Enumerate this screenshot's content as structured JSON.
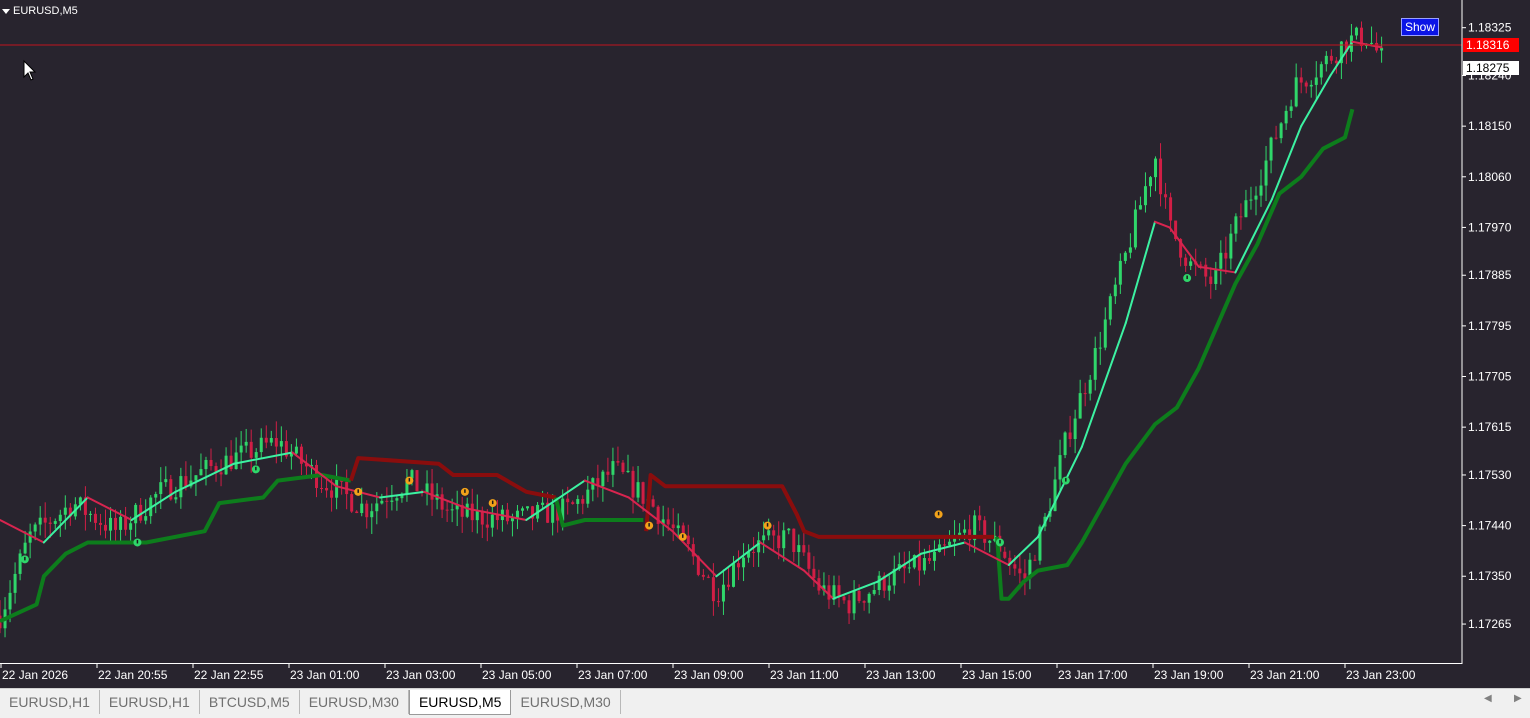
{
  "window": {
    "symbol_label": "EURUSD,M5",
    "show_button": "Show"
  },
  "tabs": [
    {
      "label": "EURUSD,H1",
      "active": false
    },
    {
      "label": "EURUSD,H1",
      "active": false
    },
    {
      "label": "BTCUSD,M5",
      "active": false
    },
    {
      "label": "EURUSD,M30",
      "active": false
    },
    {
      "label": "EURUSD,M5",
      "active": true
    },
    {
      "label": "EURUSD,M30",
      "active": false
    }
  ],
  "tab_scroll": {
    "left_icon": "triangle-left-icon",
    "right_icon": "triangle-right-icon"
  },
  "colors": {
    "background": "#28242e",
    "bull_candle": "#2fd66a",
    "bear_candle": "#d11e45",
    "ma_up": "#3cf2a2",
    "ma_down": "#d8244f",
    "trail_support": "#0d7d1c",
    "trail_resistance": "#8a0d0d",
    "ask_line": "#c0151f",
    "ask_badge": "#ff0000",
    "bid_badge": "#ffffff",
    "signal_up": "#2fd66a",
    "signal_down": "#f2a21a"
  },
  "chart_data": {
    "type": "candlestick",
    "symbol": "EURUSD",
    "timeframe": "M5",
    "ylim": [
      1.1721,
      1.1836
    ],
    "y_ticks": [
      "1.18325",
      "1.18240",
      "1.18150",
      "1.18060",
      "1.17970",
      "1.17885",
      "1.17795",
      "1.17705",
      "1.17615",
      "1.17530",
      "1.17440",
      "1.17350",
      "1.17265"
    ],
    "x_ticks": [
      "22 Jan 2026",
      "22 Jan 20:55",
      "22 Jan 22:55",
      "23 Jan 01:00",
      "23 Jan 03:00",
      "23 Jan 05:00",
      "23 Jan 07:00",
      "23 Jan 09:00",
      "23 Jan 11:00",
      "23 Jan 13:00",
      "23 Jan 15:00",
      "23 Jan 17:00",
      "23 Jan 19:00",
      "23 Jan 21:00",
      "23 Jan 23:00"
    ],
    "ask_price": "1.18316",
    "bid_price": "1.18275",
    "price_path": [
      [
        0,
        1.1728
      ],
      [
        0.02,
        1.1742
      ],
      [
        0.05,
        1.1748
      ],
      [
        0.08,
        1.1743
      ],
      [
        0.11,
        1.175
      ],
      [
        0.15,
        1.1755
      ],
      [
        0.19,
        1.1759
      ],
      [
        0.22,
        1.1752
      ],
      [
        0.25,
        1.1747
      ],
      [
        0.28,
        1.1752
      ],
      [
        0.31,
        1.1746
      ],
      [
        0.35,
        1.1745
      ],
      [
        0.39,
        1.1747
      ],
      [
        0.42,
        1.1754
      ],
      [
        0.445,
        1.1748
      ],
      [
        0.47,
        1.174
      ],
      [
        0.49,
        1.1732
      ],
      [
        0.51,
        1.174
      ],
      [
        0.54,
        1.1742
      ],
      [
        0.56,
        1.1733
      ],
      [
        0.58,
        1.173
      ],
      [
        0.61,
        1.1735
      ],
      [
        0.64,
        1.1738
      ],
      [
        0.665,
        1.1744
      ],
      [
        0.685,
        1.174
      ],
      [
        0.7,
        1.1734
      ],
      [
        0.715,
        1.1745
      ],
      [
        0.73,
        1.176
      ],
      [
        0.75,
        1.1775
      ],
      [
        0.77,
        1.1792
      ],
      [
        0.79,
        1.181
      ],
      [
        0.8,
        1.1797
      ],
      [
        0.815,
        1.179
      ],
      [
        0.83,
        1.1787
      ],
      [
        0.845,
        1.1797
      ],
      [
        0.865,
        1.1808
      ],
      [
        0.885,
        1.1822
      ],
      [
        0.905,
        1.1826
      ],
      [
        0.92,
        1.183
      ],
      [
        0.935,
        1.1831
      ],
      [
        0.945,
        1.1827
      ]
    ],
    "ma_path": [
      [
        0,
        1.1745
      ],
      [
        0.03,
        1.1741
      ],
      [
        0.06,
        1.1749
      ],
      [
        0.09,
        1.1745
      ],
      [
        0.12,
        1.175
      ],
      [
        0.16,
        1.1755
      ],
      [
        0.2,
        1.1757
      ],
      [
        0.23,
        1.1751
      ],
      [
        0.26,
        1.1749
      ],
      [
        0.29,
        1.175
      ],
      [
        0.32,
        1.1747
      ],
      [
        0.36,
        1.1745
      ],
      [
        0.4,
        1.1752
      ],
      [
        0.43,
        1.1749
      ],
      [
        0.46,
        1.1743
      ],
      [
        0.49,
        1.1735
      ],
      [
        0.52,
        1.1741
      ],
      [
        0.55,
        1.1736
      ],
      [
        0.57,
        1.1731
      ],
      [
        0.6,
        1.1734
      ],
      [
        0.63,
        1.1739
      ],
      [
        0.66,
        1.1741
      ],
      [
        0.69,
        1.1737
      ],
      [
        0.71,
        1.1742
      ],
      [
        0.74,
        1.1758
      ],
      [
        0.77,
        1.178
      ],
      [
        0.79,
        1.1798
      ],
      [
        0.8,
        1.1797
      ],
      [
        0.82,
        1.179
      ],
      [
        0.845,
        1.1789
      ],
      [
        0.87,
        1.1802
      ],
      [
        0.89,
        1.1815
      ],
      [
        0.91,
        1.1824
      ],
      [
        0.925,
        1.183
      ],
      [
        0.945,
        1.1829
      ]
    ],
    "trail_segments": [
      {
        "side": "support",
        "points": [
          [
            0,
            1.1727
          ],
          [
            0.025,
            1.173
          ],
          [
            0.03,
            1.1735
          ],
          [
            0.045,
            1.1739
          ],
          [
            0.06,
            1.1741
          ],
          [
            0.1,
            1.1741
          ],
          [
            0.14,
            1.1743
          ],
          [
            0.15,
            1.1748
          ],
          [
            0.18,
            1.1749
          ],
          [
            0.19,
            1.1752
          ],
          [
            0.22,
            1.1753
          ],
          [
            0.24,
            1.1752
          ]
        ]
      },
      {
        "side": "resistance",
        "points": [
          [
            0.24,
            1.1752
          ],
          [
            0.245,
            1.1756
          ],
          [
            0.3,
            1.1755
          ],
          [
            0.31,
            1.1753
          ],
          [
            0.34,
            1.1753
          ],
          [
            0.36,
            1.175
          ],
          [
            0.38,
            1.1749
          ]
        ]
      },
      {
        "side": "support",
        "points": [
          [
            0.38,
            1.1749
          ],
          [
            0.385,
            1.1744
          ],
          [
            0.4,
            1.1745
          ],
          [
            0.44,
            1.1745
          ]
        ]
      },
      {
        "side": "resistance",
        "points": [
          [
            0.442,
            1.1743
          ],
          [
            0.445,
            1.1753
          ],
          [
            0.455,
            1.1751
          ],
          [
            0.535,
            1.1751
          ],
          [
            0.545,
            1.1746
          ],
          [
            0.55,
            1.1743
          ],
          [
            0.56,
            1.1742
          ],
          [
            0.68,
            1.1742
          ]
        ]
      },
      {
        "side": "support",
        "points": [
          [
            0.682,
            1.1742
          ],
          [
            0.685,
            1.1731
          ],
          [
            0.69,
            1.1731
          ],
          [
            0.7,
            1.1734
          ],
          [
            0.71,
            1.1736
          ],
          [
            0.73,
            1.1737
          ],
          [
            0.74,
            1.1741
          ],
          [
            0.77,
            1.1755
          ],
          [
            0.79,
            1.1762
          ],
          [
            0.805,
            1.1765
          ],
          [
            0.82,
            1.1772
          ],
          [
            0.845,
            1.1787
          ],
          [
            0.86,
            1.1794
          ],
          [
            0.875,
            1.1803
          ],
          [
            0.89,
            1.1806
          ],
          [
            0.905,
            1.1811
          ],
          [
            0.92,
            1.1813
          ],
          [
            0.925,
            1.1818
          ]
        ]
      }
    ],
    "signals": [
      {
        "t": 0.017,
        "price": 1.1738,
        "dir": "up"
      },
      {
        "t": 0.094,
        "price": 1.1741,
        "dir": "up"
      },
      {
        "t": 0.175,
        "price": 1.1754,
        "dir": "up"
      },
      {
        "t": 0.245,
        "price": 1.175,
        "dir": "down"
      },
      {
        "t": 0.28,
        "price": 1.1752,
        "dir": "down"
      },
      {
        "t": 0.318,
        "price": 1.175,
        "dir": "down"
      },
      {
        "t": 0.337,
        "price": 1.1748,
        "dir": "down"
      },
      {
        "t": 0.444,
        "price": 1.1744,
        "dir": "down"
      },
      {
        "t": 0.467,
        "price": 1.1742,
        "dir": "down"
      },
      {
        "t": 0.525,
        "price": 1.1744,
        "dir": "down"
      },
      {
        "t": 0.642,
        "price": 1.1746,
        "dir": "down"
      },
      {
        "t": 0.684,
        "price": 1.1741,
        "dir": "up"
      },
      {
        "t": 0.729,
        "price": 1.1752,
        "dir": "up"
      },
      {
        "t": 0.812,
        "price": 1.1788,
        "dir": "up"
      }
    ]
  }
}
